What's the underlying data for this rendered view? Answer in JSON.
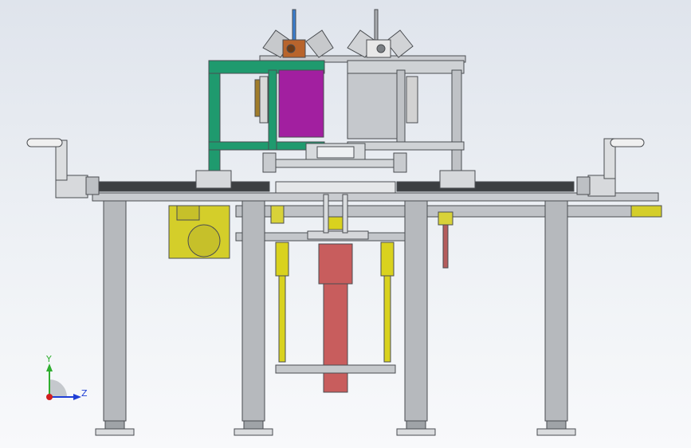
{
  "viewport": {
    "background": "#e6e9ef"
  },
  "triad": {
    "y_label": "Y",
    "z_label": "Z",
    "y_color": "#2fae2f",
    "z_color": "#1f3fd6",
    "x_color": "#d21e1e"
  },
  "colors": {
    "frame": "#b4b8bc",
    "frame_dark": "#5a5e62",
    "green_frame": "#1f9a6e",
    "magenta_block": "#a21fa0",
    "yellow": "#d9d21e",
    "red_cylinder": "#c85d5d",
    "motor_yellow": "#d4ce2a",
    "blue_rod": "#3a7fd0",
    "rack": "#3c3f42"
  }
}
